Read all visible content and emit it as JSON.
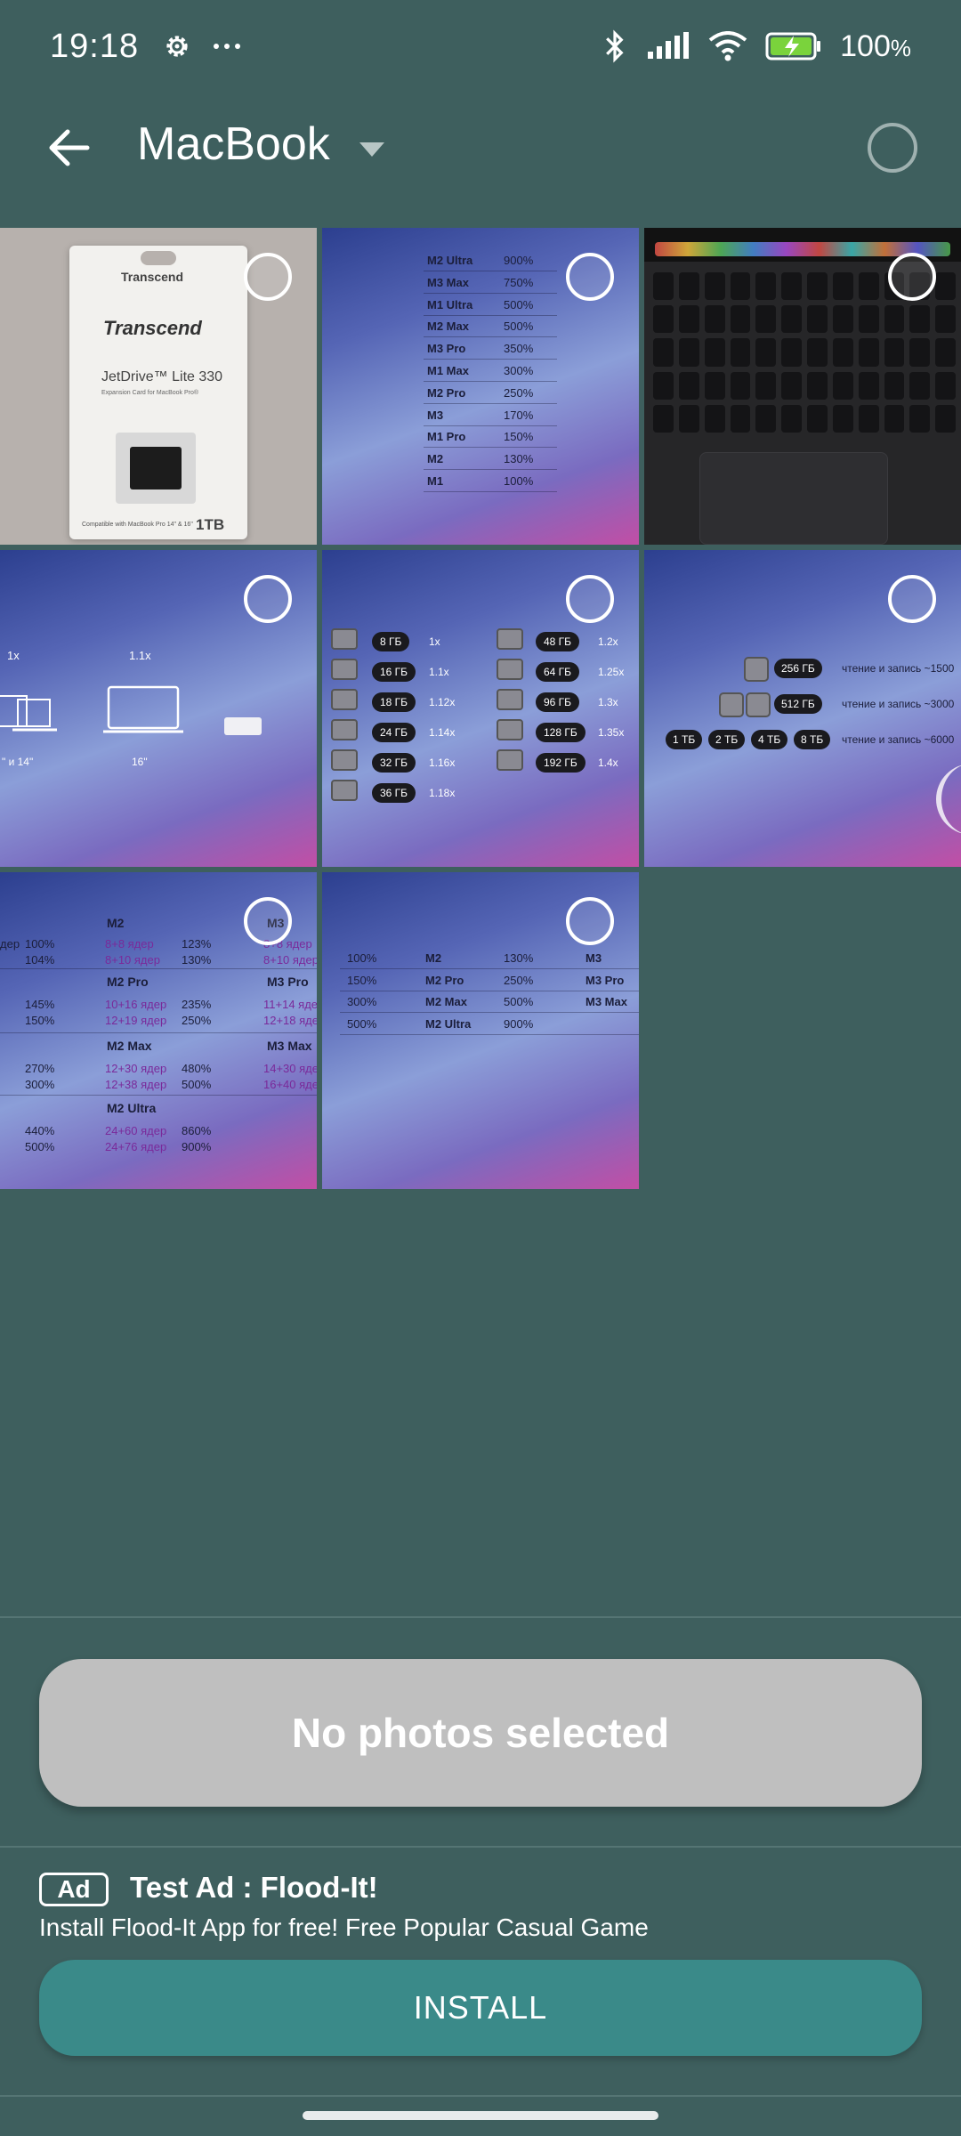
{
  "status_bar": {
    "time": "19:18",
    "battery_percent": "100",
    "battery_unit": "%",
    "icons": [
      "gear-icon",
      "more-dots-icon",
      "bluetooth-icon",
      "signal-icon",
      "wifi-icon",
      "battery-charging-icon"
    ]
  },
  "app_bar": {
    "title": "MacBook",
    "back_icon": "arrow-left-icon",
    "dropdown_icon": "caret-down-icon"
  },
  "photos": {
    "p1": {
      "brand": "Transcend",
      "product": "JetDrive™ Lite 330",
      "subtitle": "Expansion Card for MacBook Pro®",
      "compat": "Compatible with MacBook Pro 14\" & 16\"",
      "capacity": "1TB"
    },
    "p2": {
      "rows": [
        {
          "chip": "M2 Ultra",
          "pct": "900%"
        },
        {
          "chip": "M3 Max",
          "pct": "750%"
        },
        {
          "chip": "M1 Ultra",
          "pct": "500%"
        },
        {
          "chip": "M2 Max",
          "pct": "500%"
        },
        {
          "chip": "M3 Pro",
          "pct": "350%"
        },
        {
          "chip": "M1 Max",
          "pct": "300%"
        },
        {
          "chip": "M2 Pro",
          "pct": "250%"
        },
        {
          "chip": "M3",
          "pct": "170%"
        },
        {
          "chip": "M1 Pro",
          "pct": "150%"
        },
        {
          "chip": "M2",
          "pct": "130%"
        },
        {
          "chip": "M1",
          "pct": "100%"
        }
      ]
    },
    "p4": {
      "a": "1x",
      "b": "1.1x",
      "c": "\" и 14\"",
      "d": "16\""
    },
    "p5": {
      "left": [
        {
          "mem": "8 ГБ",
          "x": "1x"
        },
        {
          "mem": "16 ГБ",
          "x": "1.1x"
        },
        {
          "mem": "18 ГБ",
          "x": "1.12x"
        },
        {
          "mem": "24 ГБ",
          "x": "1.14x"
        },
        {
          "mem": "32 ГБ",
          "x": "1.16x"
        },
        {
          "mem": "36 ГБ",
          "x": "1.18x"
        }
      ],
      "right": [
        {
          "mem": "48 ГБ",
          "x": "1.2x"
        },
        {
          "mem": "64 ГБ",
          "x": "1.25x"
        },
        {
          "mem": "96 ГБ",
          "x": "1.3x"
        },
        {
          "mem": "128 ГБ",
          "x": "1.35x"
        },
        {
          "mem": "192 ГБ",
          "x": "1.4x"
        }
      ]
    },
    "p6": {
      "r1": {
        "size": "256 ГБ",
        "text": "чтение и запись ~1500"
      },
      "r2": {
        "size": "512 ГБ",
        "text": "чтение и запись ~3000"
      },
      "r3": {
        "sizes": [
          "1 ТБ",
          "2 ТБ",
          "4 ТБ",
          "8 ТБ"
        ],
        "text": "чтение и запись ~6000"
      }
    },
    "p7": {
      "h1": "M2",
      "h2": "M2 Pro",
      "h3": "M2 Max",
      "h4": "M2 Ultra",
      "hr1": "M3",
      "hr2": "M3 Pro",
      "hr3": "M3 Max",
      "lines": [
        [
          "дер",
          "100%",
          "8+8 ядер",
          "123%",
          "8+8 ядер"
        ],
        [
          "",
          "104%",
          "8+10 ядер",
          "130%",
          "8+10 ядер"
        ],
        [
          "",
          "145%",
          "10+16 ядер",
          "235%",
          "11+14 ядер"
        ],
        [
          "",
          "150%",
          "12+19 ядер",
          "250%",
          "12+18 ядер"
        ],
        [
          "",
          "270%",
          "12+30 ядер",
          "480%",
          "14+30 ядер"
        ],
        [
          "",
          "300%",
          "12+38 ядер",
          "500%",
          "16+40 ядер"
        ],
        [
          "",
          "440%",
          "24+60 ядер",
          "860%",
          ""
        ],
        [
          "",
          "500%",
          "24+76 ядер",
          "900%",
          ""
        ]
      ]
    },
    "p8": {
      "rows": [
        {
          "a": "100%",
          "chip": "M2",
          "b": "130%",
          "c": "M3"
        },
        {
          "a": "150%",
          "chip": "M2 Pro",
          "b": "250%",
          "c": "M3 Pro"
        },
        {
          "a": "300%",
          "chip": "M2 Max",
          "b": "500%",
          "c": "M3 Max"
        },
        {
          "a": "500%",
          "chip": "M2 Ultra",
          "b": "900%",
          "c": ""
        }
      ]
    }
  },
  "selection_button": {
    "label": "No photos selected"
  },
  "ad": {
    "badge": "Ad",
    "title": "Test Ad : Flood-It!",
    "description": "Install Flood-It App for free! Free Popular Casual Game",
    "install_label": "INSTALL"
  },
  "colors": {
    "background": "#3e5f5e",
    "disabled_button": "#bfbfbf",
    "install_button": "#3a8a89"
  }
}
